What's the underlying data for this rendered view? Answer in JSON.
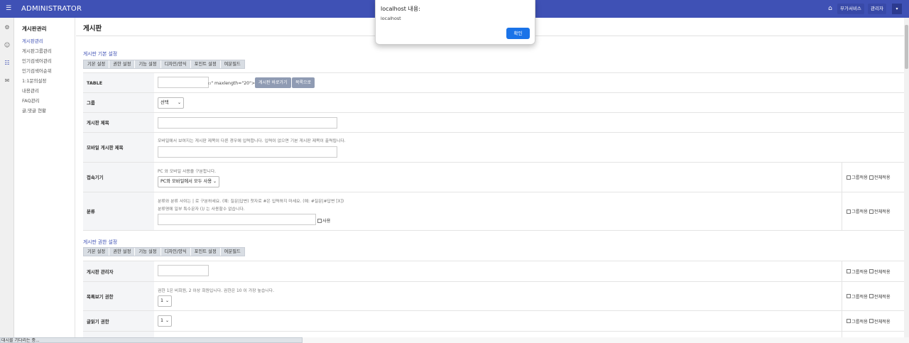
{
  "topbar": {
    "brand": "ADMINISTRATOR",
    "menu_icon": "hamburger-icon",
    "home_icon": "home-icon",
    "addon_label": "부가서비스",
    "admin_label": "관리자",
    "caret": "▾"
  },
  "iconbar": [
    "gear-icon",
    "user-icon",
    "list-icon",
    "mail-icon"
  ],
  "sidebar": {
    "title": "게시판관리",
    "items": [
      {
        "label": "게시판관리"
      },
      {
        "label": "게시판그룹관리"
      },
      {
        "label": "인기검색어관리"
      },
      {
        "label": "인기검색어순위"
      },
      {
        "label": "1:1문의설정"
      },
      {
        "label": "내용관리"
      },
      {
        "label": "FAQ관리"
      },
      {
        "label": "글,댓글 현황"
      }
    ]
  },
  "page": {
    "title": "게시판"
  },
  "tabs": [
    "기본 설정",
    "권한 설정",
    "기능 설정",
    "디자인/양식",
    "포인트 설정",
    "여분필드"
  ],
  "section1": {
    "title": "게시판 기본 설정",
    "table": {
      "label": "TABLE",
      "broken_text": "\" maxlength=\"20\">",
      "btn_go": "게시판 바로가기",
      "btn_list": "목록으로"
    },
    "group": {
      "label": "그룹",
      "value": "선택"
    },
    "subject": {
      "label": "게시판 제목"
    },
    "mobile_subject": {
      "label": "모바일 게시판 제목",
      "hint": "모바일에서 보여지는 게시판 제목이 다른 경우에 입력합니다. 입력이 없으면 기본 게시판 제목이 출력됩니다."
    },
    "device": {
      "label": "접속기기",
      "hint": "PC 와 모바일 사용을 구분합니다.",
      "value": "PC와 모바일에서 모두 사용"
    },
    "category": {
      "label": "분류",
      "hint1": "분류와 분류 사이는 | 로 구분하세요. (예: 질문|답변) 첫자로 #은 입력하지 마세요. (예: #질문|#답변 [X])",
      "hint2": "분류명에 일부 특수문자 ()/ 는 사용할수 없습니다.",
      "use_label": "사용"
    }
  },
  "section2": {
    "title": "게시판 권한 설정",
    "admin": {
      "label": "게시판 관리자"
    },
    "list_level": {
      "label": "목록보기 권한",
      "hint": "권한 1은 비회원, 2 이상 회원입니다. 권한은 10 이 가장 높습니다.",
      "value": "1"
    },
    "read_level": {
      "label": "글읽기 권한",
      "value": "1"
    }
  },
  "apply": {
    "group": "그룹적용",
    "all": "전체적용"
  },
  "status": {
    "text": "대시를 기다리는 중..."
  },
  "dialog": {
    "title": "localhost 내용:",
    "message": "localhost",
    "ok": "확인"
  },
  "colors": {
    "primary": "#3f51b5",
    "ok_button": "#1a73e8"
  }
}
